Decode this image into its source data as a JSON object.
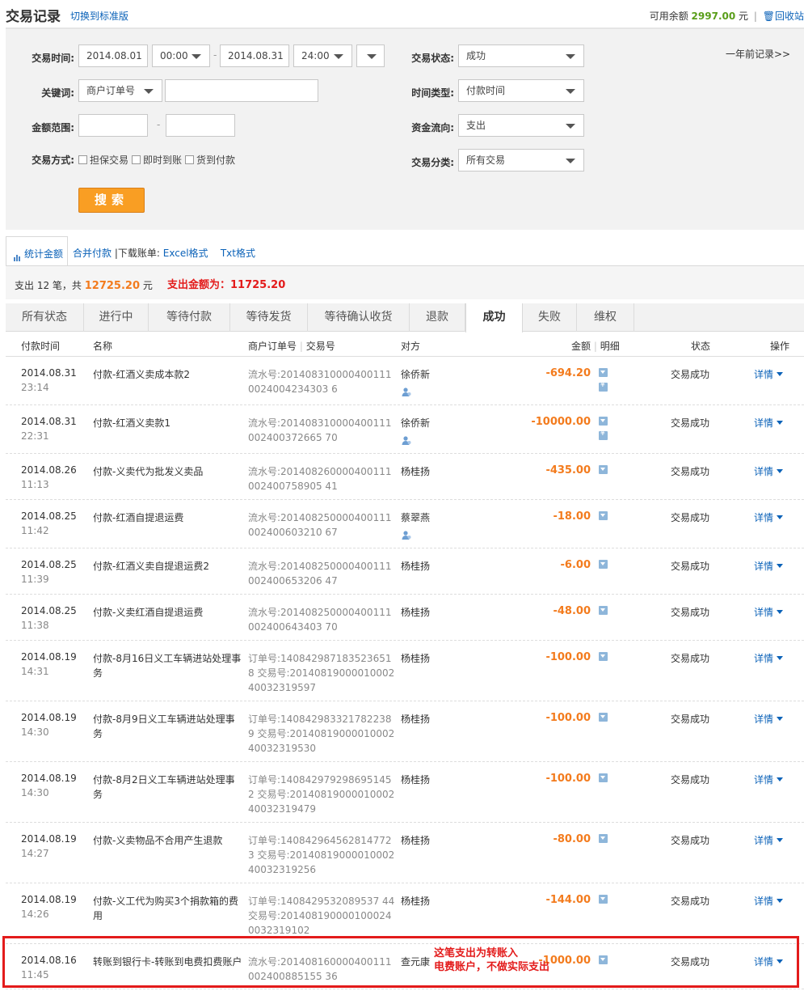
{
  "header": {
    "title": "交易记录",
    "switch_link": "切换到标准版",
    "balance_label": "可用余额",
    "balance_amount": "2997.00",
    "balance_unit": "元",
    "separator": "|",
    "trash_link": "回收站"
  },
  "filter": {
    "time_label": "交易时间:",
    "date_from": "2014.08.01",
    "time_from": "00:00",
    "dash": "-",
    "date_to": "2014.08.31",
    "time_to": "24:00",
    "status_label": "交易状态:",
    "status_value": "成功",
    "one_year_link": "一年前记录>>",
    "keyword_label": "关键词:",
    "keyword_type": "商户订单号",
    "keyword_value": "",
    "time_type_label": "时间类型:",
    "time_type_value": "付款时间",
    "amount_label": "金额范围:",
    "amount_min": "",
    "amount_max": "",
    "flow_label": "资金流向:",
    "flow_value": "支出",
    "method_label": "交易方式:",
    "methods": [
      "担保交易",
      "即时到账",
      "货到付款"
    ],
    "category_label": "交易分类:",
    "category_value": "所有交易",
    "search_button": "搜索"
  },
  "toolbar": {
    "stats_tab": "统计金额",
    "merge_pay": "合并付款",
    "download_label": "|下载账单:",
    "excel": "Excel格式",
    "txt": "Txt格式"
  },
  "summary": {
    "prefix": "支出 12 笔，共",
    "total": "12725.20",
    "unit": "元",
    "note": "支出金额为：11725.20"
  },
  "tabs": [
    "所有状态",
    "进行中",
    "等待付款",
    "等待发货",
    "等待确认收货",
    "退款",
    "成功",
    "失败",
    "维权"
  ],
  "active_tab": "成功",
  "table": {
    "headers": {
      "time": "付款时间",
      "name": "名称",
      "order": "商户订单号",
      "sep": "|",
      "trade": "交易号",
      "party": "对方",
      "amount": "金额",
      "detail": "明细",
      "status": "状态",
      "action": "操作"
    },
    "rows": [
      {
        "date": "2014.08.31",
        "time": "23:14",
        "name": "付款-红酒义卖成本款2",
        "order": "流水号:2014083100004001110024004234303 6",
        "party": "徐侨新",
        "amount": "-694.20",
        "status": "交易成功",
        "action": "详情",
        "person_icon": true,
        "second_icon": true
      },
      {
        "date": "2014.08.31",
        "time": "22:31",
        "name": "付款-红酒义卖款1",
        "order": "流水号:201408310000400111002400372665 70",
        "party": "徐侨新",
        "amount": "-10000.00",
        "status": "交易成功",
        "action": "详情",
        "person_icon": true,
        "second_icon": true
      },
      {
        "date": "2014.08.26",
        "time": "11:13",
        "name": "付款-义卖代为批发义卖品",
        "order": "流水号:201408260000400111002400758905 41",
        "party": "杨桂扬",
        "amount": "-435.00",
        "status": "交易成功",
        "action": "详情",
        "person_icon": false,
        "second_icon": false
      },
      {
        "date": "2014.08.25",
        "time": "11:42",
        "name": "付款-红酒自提退运费",
        "order": "流水号:201408250000400111002400603210 67",
        "party": "蔡翠燕",
        "amount": "-18.00",
        "status": "交易成功",
        "action": "详情",
        "person_icon": true,
        "second_icon": false
      },
      {
        "date": "2014.08.25",
        "time": "11:39",
        "name": "付款-红酒义卖自提退运费2",
        "order": "流水号:201408250000400111002400653206 47",
        "party": "杨桂扬",
        "amount": "-6.00",
        "status": "交易成功",
        "action": "详情",
        "person_icon": false,
        "second_icon": false
      },
      {
        "date": "2014.08.25",
        "time": "11:38",
        "name": "付款-义卖红酒自提退运费",
        "order": "流水号:201408250000400111002400643403 70",
        "party": "杨桂扬",
        "amount": "-48.00",
        "status": "交易成功",
        "action": "详情",
        "person_icon": false,
        "second_icon": false
      },
      {
        "date": "2014.08.19",
        "time": "14:31",
        "name": "付款-8月16日义工车辆进站处理事务",
        "order": "订单号:1408429871835236518 交易号:2014081900001000240032319597",
        "party": "杨桂扬",
        "amount": "-100.00",
        "status": "交易成功",
        "action": "详情",
        "person_icon": false,
        "second_icon": false
      },
      {
        "date": "2014.08.19",
        "time": "14:30",
        "name": "付款-8月9日义工车辆进站处理事务",
        "order": "订单号:1408429833217822389 交易号:2014081900001000240032319530",
        "party": "杨桂扬",
        "amount": "-100.00",
        "status": "交易成功",
        "action": "详情",
        "person_icon": false,
        "second_icon": false
      },
      {
        "date": "2014.08.19",
        "time": "14:30",
        "name": "付款-8月2日义工车辆进站处理事务",
        "order": "订单号:1408429792986951452 交易号:2014081900001000240032319479",
        "party": "杨桂扬",
        "amount": "-100.00",
        "status": "交易成功",
        "action": "详情",
        "person_icon": false,
        "second_icon": false
      },
      {
        "date": "2014.08.19",
        "time": "14:27",
        "name": "付款-义卖物品不合用产生退款",
        "order": "订单号:1408429645628147723 交易号:2014081900001000240032319256",
        "party": "杨桂扬",
        "amount": "-80.00",
        "status": "交易成功",
        "action": "详情",
        "person_icon": false,
        "second_icon": false
      },
      {
        "date": "2014.08.19",
        "time": "14:26",
        "name": "付款-义工代为购买3个捐款箱的费用",
        "order": "订单号:1408429532089537 44 交易号:2014081900001000240032319102",
        "party": "杨桂扬",
        "amount": "-144.00",
        "status": "交易成功",
        "action": "详情",
        "person_icon": false,
        "second_icon": false
      },
      {
        "date": "2014.08.16",
        "time": "11:45",
        "name": "转账到银行卡-转账到电费扣费账户",
        "order": "流水号:201408160000400111002400885155 36",
        "party": "查元康",
        "amount": "-1000.00",
        "status": "交易成功",
        "action": "详情",
        "person_icon": false,
        "second_icon": false
      }
    ]
  },
  "annotation": {
    "line1": "这笔支出为转账入",
    "line2": "电费账户，不做实际支出"
  },
  "colors": {
    "accent_orange": "#f37b1d",
    "link_blue": "#0b62b8",
    "annotation_red": "#e31b1b",
    "balance_green": "#5a9e1a"
  }
}
